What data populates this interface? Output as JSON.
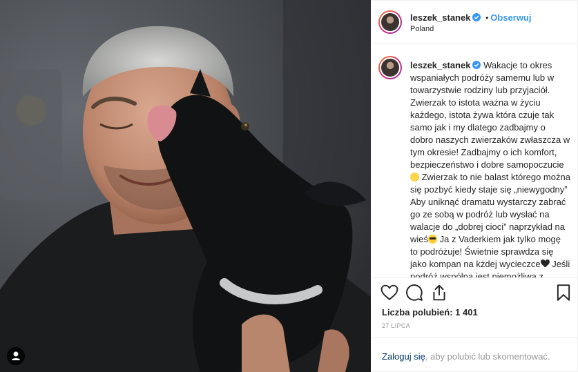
{
  "post": {
    "username": "leszek_stanek",
    "verified": true,
    "follow_label": "Obserwuj",
    "separator": "•",
    "location": "Poland"
  },
  "caption": {
    "username": "leszek_stanek",
    "part1": " Wakacje to okres wspaniałych podróży samemu lub w towarzystwie rodziny lub przyjaciół. Zwierzak to istota ważna w życiu każdego, istota żywa która czuje tak samo jak i my dlatego zadbajmy o dobro naszych zwierzaków zwłaszcza w tym okresie! Zadbajmy o ich komfort, bezpieczeństwo i dobre samopoczucie",
    "part2": " Zwierzak to nie balast którego można się pozbyć kiedy staje się „niewygodny” Aby uniknąć dramatu wystarczy zabrać go ze sobą w podróż lub wysłać na walacje do „dobrej cioci” naprzykład na wieś",
    "part3": " Ja z Vaderkiem jak tylko mogę to podróżuje! Świetnie sprawdza się jako kompan na kżdej wycieczce",
    "part4": " Jeśli podróż wspólna jest niemożliwa z jakiegoś względu, to",
    "emoji_1": "smiling-face",
    "emoji_2": "sunglasses-face",
    "emoji_3": "black-heart"
  },
  "stats": {
    "likes_label": "Liczba polubień: 1 401",
    "date": "27 LIPCA"
  },
  "login": {
    "link": "Zaloguj się",
    "rest": ", aby polubić lub skomentować."
  },
  "icons": {
    "like": "heart-icon",
    "comment": "comment-icon",
    "share": "share-icon",
    "save": "bookmark-icon"
  },
  "colors": {
    "link_blue": "#3897f0",
    "verified_blue": "#3897f0",
    "muted": "#999999",
    "login_link": "#003569"
  }
}
